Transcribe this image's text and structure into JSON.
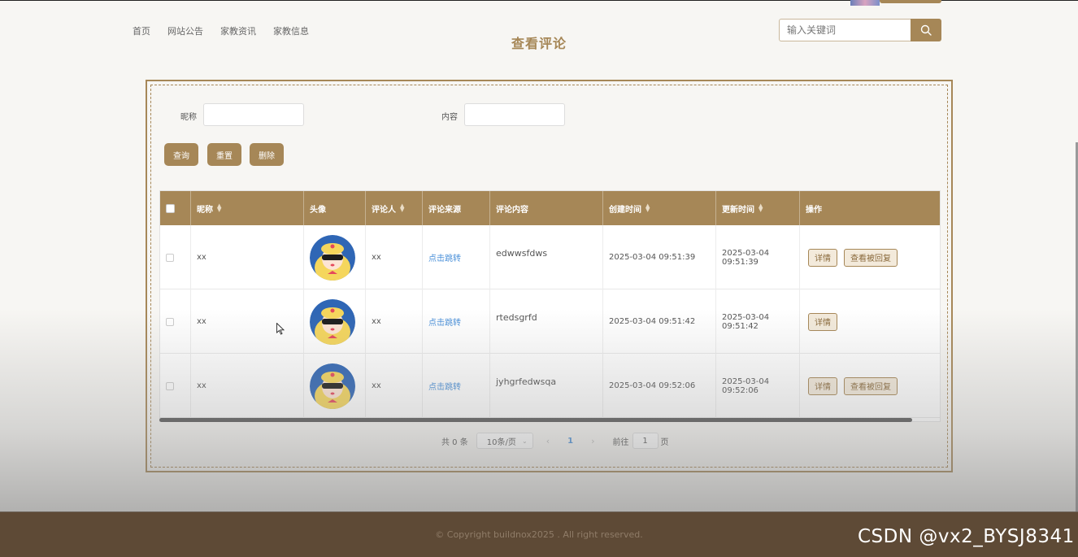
{
  "nav": {
    "items": [
      "首页",
      "网站公告",
      "家教资讯",
      "家教信息"
    ]
  },
  "page": {
    "title": "查看评论"
  },
  "search": {
    "placeholder": "输入关键词"
  },
  "filters": {
    "nickname_label": "昵称",
    "content_label": "内容",
    "query_button": "查询",
    "reset_button": "重置",
    "delete_button": "删除"
  },
  "table": {
    "headers": [
      "昵称",
      "头像",
      "评论人",
      "评论来源",
      "评论内容",
      "创建时间",
      "更新时间",
      "操作"
    ],
    "rows": [
      {
        "nickname": "xx",
        "commenter": "xx",
        "source": "点击跳转",
        "content": "edwwsfdws",
        "created": "2025-03-04 09:51:39",
        "updated": "2025-03-04 09:51:39",
        "detail": "详情",
        "view_reply": "查看被回复"
      },
      {
        "nickname": "xx",
        "commenter": "xx",
        "source": "点击跳转",
        "content": "rtedsgrfd",
        "created": "2025-03-04 09:51:42",
        "updated": "2025-03-04 09:51:42",
        "detail": "详情",
        "view_reply": ""
      },
      {
        "nickname": "xx",
        "commenter": "xx",
        "source": "点击跳转",
        "content": "jyhgrfedwsqa",
        "created": "2025-03-04 09:52:06",
        "updated": "2025-03-04 09:52:06",
        "detail": "详情",
        "view_reply": "查看被回复"
      }
    ]
  },
  "pagination": {
    "total": "共 0 条",
    "page_size": "10条/页",
    "current_page": "1",
    "goto_label": "前往",
    "goto_value": "1",
    "page_suffix": "页"
  },
  "footer": {
    "copyright": "© Copyright buildnox2025 . All right reserved."
  },
  "watermark": "CSDN @vx2_BYSJ8341",
  "colors": {
    "accent": "#a68757",
    "footer_bg": "#5e4a36",
    "link": "#4a90d9"
  }
}
